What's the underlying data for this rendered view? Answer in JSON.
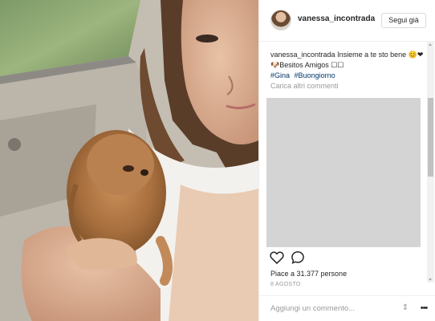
{
  "post": {
    "username": "vanessa_incontrada",
    "follow_label": "Segui già",
    "caption_user": "vanessa_incontrada",
    "caption_text": " Insieme a te sto bene 😊❤🐶Besitos Amigos ☐☐",
    "hashtags": [
      "#Gina",
      "#Buongiorno"
    ],
    "load_more_comments": "Carica altri commenti",
    "likes_text": "Piace a 31.377 persone",
    "date": "8 AGOSTO",
    "comment_placeholder": "Aggiungi un commento...",
    "icons": {
      "like": "heart-icon",
      "comment": "speech-bubble-icon",
      "options": "up-down-arrows-icon",
      "more": "more-dots-icon"
    }
  },
  "colors": {
    "link": "#003569",
    "muted": "#999999",
    "border": "#efefef",
    "placeholder_box": "#d4d4d4"
  }
}
